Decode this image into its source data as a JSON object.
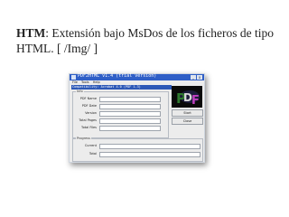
{
  "caption": {
    "bold_label": "HTM",
    "text": ": Extensión bajo MsDos de los ficheros de tipo HTML. [ /Img/ ]"
  },
  "window": {
    "title": "PDF2HTML v1.4 (trial version)",
    "controls": {
      "minimize": "_",
      "close": "x"
    },
    "menu": [
      "File",
      "Tools",
      "Help"
    ],
    "header": "Compatibility: Acrobat 4.0 (PDF 1.3)",
    "info_group": "Info",
    "info_fields": [
      {
        "label": "PDF Name",
        "value": ""
      },
      {
        "label": "PDF Date",
        "value": ""
      },
      {
        "label": "Version",
        "value": ""
      },
      {
        "label": "Total Pages",
        "value": ""
      },
      {
        "label": "Total Files",
        "value": ""
      }
    ],
    "buttons": {
      "start": "Start",
      "close": "Close"
    },
    "progress_group": "Progress",
    "progress_fields": [
      {
        "label": "Current",
        "value": ""
      },
      {
        "label": "Total",
        "value": ""
      }
    ]
  },
  "colors": {
    "titlebar": "#2f5fc7",
    "header_band": "#2d59b7",
    "logo_bg": "#0a0a0a",
    "logo_p": "#2f7a2f",
    "logo_d": "#d9d9d9",
    "logo_f": "#c040c0"
  }
}
